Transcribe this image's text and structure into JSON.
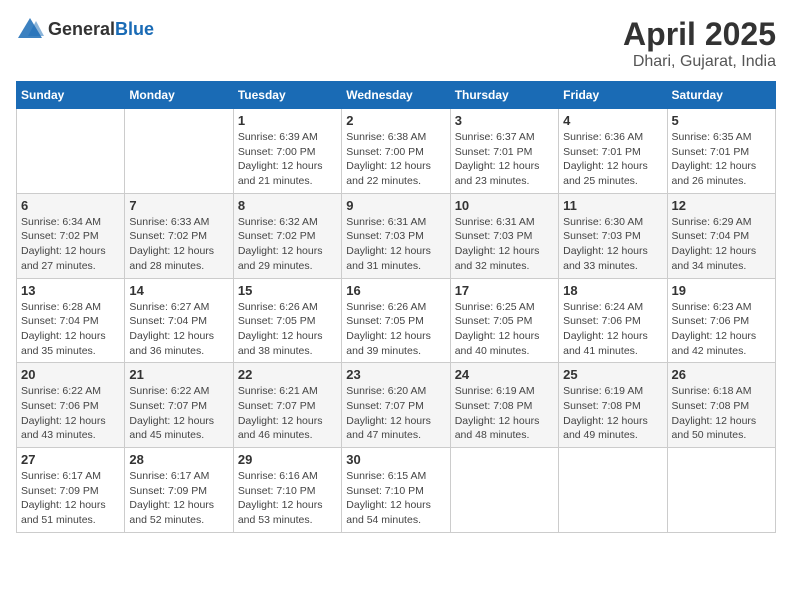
{
  "header": {
    "logo_general": "General",
    "logo_blue": "Blue",
    "month_title": "April 2025",
    "location": "Dhari, Gujarat, India"
  },
  "weekdays": [
    "Sunday",
    "Monday",
    "Tuesday",
    "Wednesday",
    "Thursday",
    "Friday",
    "Saturday"
  ],
  "weeks": [
    [
      {
        "day": "",
        "sunrise": "",
        "sunset": "",
        "daylight": ""
      },
      {
        "day": "",
        "sunrise": "",
        "sunset": "",
        "daylight": ""
      },
      {
        "day": "1",
        "sunrise": "Sunrise: 6:39 AM",
        "sunset": "Sunset: 7:00 PM",
        "daylight": "Daylight: 12 hours and 21 minutes."
      },
      {
        "day": "2",
        "sunrise": "Sunrise: 6:38 AM",
        "sunset": "Sunset: 7:00 PM",
        "daylight": "Daylight: 12 hours and 22 minutes."
      },
      {
        "day": "3",
        "sunrise": "Sunrise: 6:37 AM",
        "sunset": "Sunset: 7:01 PM",
        "daylight": "Daylight: 12 hours and 23 minutes."
      },
      {
        "day": "4",
        "sunrise": "Sunrise: 6:36 AM",
        "sunset": "Sunset: 7:01 PM",
        "daylight": "Daylight: 12 hours and 25 minutes."
      },
      {
        "day": "5",
        "sunrise": "Sunrise: 6:35 AM",
        "sunset": "Sunset: 7:01 PM",
        "daylight": "Daylight: 12 hours and 26 minutes."
      }
    ],
    [
      {
        "day": "6",
        "sunrise": "Sunrise: 6:34 AM",
        "sunset": "Sunset: 7:02 PM",
        "daylight": "Daylight: 12 hours and 27 minutes."
      },
      {
        "day": "7",
        "sunrise": "Sunrise: 6:33 AM",
        "sunset": "Sunset: 7:02 PM",
        "daylight": "Daylight: 12 hours and 28 minutes."
      },
      {
        "day": "8",
        "sunrise": "Sunrise: 6:32 AM",
        "sunset": "Sunset: 7:02 PM",
        "daylight": "Daylight: 12 hours and 29 minutes."
      },
      {
        "day": "9",
        "sunrise": "Sunrise: 6:31 AM",
        "sunset": "Sunset: 7:03 PM",
        "daylight": "Daylight: 12 hours and 31 minutes."
      },
      {
        "day": "10",
        "sunrise": "Sunrise: 6:31 AM",
        "sunset": "Sunset: 7:03 PM",
        "daylight": "Daylight: 12 hours and 32 minutes."
      },
      {
        "day": "11",
        "sunrise": "Sunrise: 6:30 AM",
        "sunset": "Sunset: 7:03 PM",
        "daylight": "Daylight: 12 hours and 33 minutes."
      },
      {
        "day": "12",
        "sunrise": "Sunrise: 6:29 AM",
        "sunset": "Sunset: 7:04 PM",
        "daylight": "Daylight: 12 hours and 34 minutes."
      }
    ],
    [
      {
        "day": "13",
        "sunrise": "Sunrise: 6:28 AM",
        "sunset": "Sunset: 7:04 PM",
        "daylight": "Daylight: 12 hours and 35 minutes."
      },
      {
        "day": "14",
        "sunrise": "Sunrise: 6:27 AM",
        "sunset": "Sunset: 7:04 PM",
        "daylight": "Daylight: 12 hours and 36 minutes."
      },
      {
        "day": "15",
        "sunrise": "Sunrise: 6:26 AM",
        "sunset": "Sunset: 7:05 PM",
        "daylight": "Daylight: 12 hours and 38 minutes."
      },
      {
        "day": "16",
        "sunrise": "Sunrise: 6:26 AM",
        "sunset": "Sunset: 7:05 PM",
        "daylight": "Daylight: 12 hours and 39 minutes."
      },
      {
        "day": "17",
        "sunrise": "Sunrise: 6:25 AM",
        "sunset": "Sunset: 7:05 PM",
        "daylight": "Daylight: 12 hours and 40 minutes."
      },
      {
        "day": "18",
        "sunrise": "Sunrise: 6:24 AM",
        "sunset": "Sunset: 7:06 PM",
        "daylight": "Daylight: 12 hours and 41 minutes."
      },
      {
        "day": "19",
        "sunrise": "Sunrise: 6:23 AM",
        "sunset": "Sunset: 7:06 PM",
        "daylight": "Daylight: 12 hours and 42 minutes."
      }
    ],
    [
      {
        "day": "20",
        "sunrise": "Sunrise: 6:22 AM",
        "sunset": "Sunset: 7:06 PM",
        "daylight": "Daylight: 12 hours and 43 minutes."
      },
      {
        "day": "21",
        "sunrise": "Sunrise: 6:22 AM",
        "sunset": "Sunset: 7:07 PM",
        "daylight": "Daylight: 12 hours and 45 minutes."
      },
      {
        "day": "22",
        "sunrise": "Sunrise: 6:21 AM",
        "sunset": "Sunset: 7:07 PM",
        "daylight": "Daylight: 12 hours and 46 minutes."
      },
      {
        "day": "23",
        "sunrise": "Sunrise: 6:20 AM",
        "sunset": "Sunset: 7:07 PM",
        "daylight": "Daylight: 12 hours and 47 minutes."
      },
      {
        "day": "24",
        "sunrise": "Sunrise: 6:19 AM",
        "sunset": "Sunset: 7:08 PM",
        "daylight": "Daylight: 12 hours and 48 minutes."
      },
      {
        "day": "25",
        "sunrise": "Sunrise: 6:19 AM",
        "sunset": "Sunset: 7:08 PM",
        "daylight": "Daylight: 12 hours and 49 minutes."
      },
      {
        "day": "26",
        "sunrise": "Sunrise: 6:18 AM",
        "sunset": "Sunset: 7:08 PM",
        "daylight": "Daylight: 12 hours and 50 minutes."
      }
    ],
    [
      {
        "day": "27",
        "sunrise": "Sunrise: 6:17 AM",
        "sunset": "Sunset: 7:09 PM",
        "daylight": "Daylight: 12 hours and 51 minutes."
      },
      {
        "day": "28",
        "sunrise": "Sunrise: 6:17 AM",
        "sunset": "Sunset: 7:09 PM",
        "daylight": "Daylight: 12 hours and 52 minutes."
      },
      {
        "day": "29",
        "sunrise": "Sunrise: 6:16 AM",
        "sunset": "Sunset: 7:10 PM",
        "daylight": "Daylight: 12 hours and 53 minutes."
      },
      {
        "day": "30",
        "sunrise": "Sunrise: 6:15 AM",
        "sunset": "Sunset: 7:10 PM",
        "daylight": "Daylight: 12 hours and 54 minutes."
      },
      {
        "day": "",
        "sunrise": "",
        "sunset": "",
        "daylight": ""
      },
      {
        "day": "",
        "sunrise": "",
        "sunset": "",
        "daylight": ""
      },
      {
        "day": "",
        "sunrise": "",
        "sunset": "",
        "daylight": ""
      }
    ]
  ]
}
